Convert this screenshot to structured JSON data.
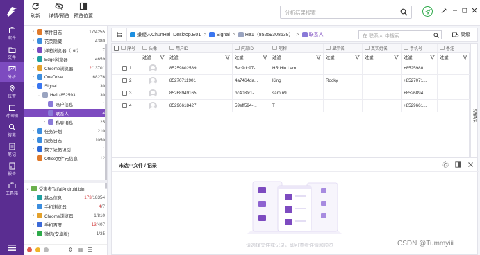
{
  "rail": {
    "items": [
      {
        "label": "案件",
        "icon": "case-icon"
      },
      {
        "label": "文件",
        "icon": "folder-icon"
      },
      {
        "label": "分析",
        "icon": "analysis-icon"
      },
      {
        "label": "位置",
        "icon": "location-icon"
      },
      {
        "label": "时间轴",
        "icon": "timeline-icon"
      },
      {
        "label": "搜索",
        "icon": "search-icon"
      },
      {
        "label": "笔记",
        "icon": "note-icon"
      },
      {
        "label": "报告",
        "icon": "report-icon"
      },
      {
        "label": "工具箱",
        "icon": "toolbox-icon"
      }
    ],
    "active_index": 2
  },
  "toolbar": {
    "refresh_label": "刷新",
    "preview_label": "详情/预览",
    "preview_pos_label": "预览位置",
    "search_placeholder": "分析结果搜索"
  },
  "tree": {
    "rows": [
      {
        "label": "事件日志",
        "count": "17/4255",
        "indent": 1,
        "arrow": ">",
        "color": "#e07a2b"
      },
      {
        "label": "花荥隐藏",
        "count": "4380",
        "indent": 1,
        "arrow": ">",
        "color": "#3c8dde"
      },
      {
        "label": "洋葱浏览器（Tor）",
        "count": "7",
        "indent": 1,
        "arrow": ">",
        "color": "#7a4bc0"
      },
      {
        "label": "Edge浏览器",
        "count": "4659",
        "indent": 1,
        "arrow": ">",
        "color": "#1ea0a0"
      },
      {
        "label": "Chrome浏览器",
        "count_red": "2",
        "count": "/13701",
        "indent": 1,
        "arrow": ">",
        "color": "#e3a12b"
      },
      {
        "label": "OneDrive",
        "count": "68276",
        "indent": 1,
        "arrow": ">",
        "color": "#3c8dde"
      },
      {
        "label": "Signal",
        "count": "30",
        "indent": 1,
        "arrow": "v",
        "color": "#3a76f0"
      },
      {
        "label": "He1 (852593...",
        "count": "30",
        "indent": 2,
        "arrow": "v",
        "color": "#9aa4c0"
      },
      {
        "label": "账户信息",
        "count": "1",
        "indent": 3,
        "arrow": "",
        "color": "#8a7ad8"
      },
      {
        "label": "联系人",
        "count": "4",
        "indent": 3,
        "arrow": "",
        "color": "#8a7ad8",
        "selected": true
      },
      {
        "label": "私聊消息",
        "count": "25",
        "indent": 3,
        "arrow": ">",
        "color": "#8a7ad8"
      },
      {
        "label": "任务计划",
        "count": "210",
        "indent": 1,
        "arrow": ">",
        "color": "#3c8dde"
      },
      {
        "label": "服务日志",
        "count": "1050",
        "indent": 1,
        "arrow": ">",
        "color": "#3c8dde"
      },
      {
        "label": "数字证据识别",
        "count": "1",
        "indent": 1,
        "arrow": ">",
        "color": "#2d6ad8"
      },
      {
        "label": "Office文件元信息",
        "count": "12",
        "indent": 1,
        "arrow": "",
        "color": "#e07a2b"
      }
    ],
    "rows2": [
      {
        "label": "受害者TaifaiAndroid.bin",
        "count": "",
        "indent": 0,
        "arrow": "v",
        "color": "#6ab04c"
      },
      {
        "label": "基本信息",
        "count_red": "173",
        "count": "/18354",
        "indent": 1,
        "arrow": ">",
        "color": "#1ea0a0"
      },
      {
        "label": "手机浏览器",
        "count_red": "4",
        "count": "/7",
        "indent": 1,
        "arrow": ">",
        "color": "#3c8dde"
      },
      {
        "label": "Chrome浏览器",
        "count": "1/810",
        "indent": 1,
        "arrow": ">",
        "color": "#e3a12b"
      },
      {
        "label": "手机百度",
        "count_red": "13",
        "count": "/407",
        "indent": 1,
        "arrow": ">",
        "color": "#3c6ad8"
      },
      {
        "label": "微信(安卓版)",
        "count": "1/35",
        "indent": 1,
        "arrow": ">",
        "color": "#2eaa4a"
      }
    ]
  },
  "breadcrumb": {
    "items": [
      {
        "label": "嫌疑人ChunHei_Desktop.E01",
        "color": "#1d8fe0"
      },
      {
        "label": "Signal",
        "color": "#3a76f0"
      },
      {
        "label": "He1（85259308538）",
        "color": "#9aa4c0"
      },
      {
        "label": "联系人",
        "color": "#8a7ad8"
      }
    ],
    "search_placeholder": "在 联系人 中搜索",
    "advanced_label": "高级"
  },
  "grid": {
    "columns": [
      "序号",
      "头像",
      "用户ID",
      "内部ID",
      "昵称",
      "显示名",
      "真实姓名",
      "手机号",
      "备注"
    ],
    "filter_label": "过滤",
    "rows": [
      {
        "index": "1",
        "user_id": "85259802589",
        "inner_id": "5ec9dc97-...",
        "nickname": "HR Hiu Lam",
        "display": "",
        "real": "",
        "phone": "+8525980...",
        "note": ""
      },
      {
        "index": "2",
        "user_id": "85270711901",
        "inner_id": "4a7464da...",
        "nickname": "King",
        "display": "Rocky",
        "real": "",
        "phone": "+8527071...",
        "note": ""
      },
      {
        "index": "3",
        "user_id": "85268949165",
        "inner_id": "bc403fc1-...",
        "nickname": "sam n9",
        "display": "",
        "real": "",
        "phone": "+8526894...",
        "note": ""
      },
      {
        "index": "4",
        "user_id": "85296618427",
        "inner_id": "59eff594-...",
        "nickname": "T",
        "display": "",
        "real": "",
        "phone": "+8529661...",
        "note": ""
      }
    ],
    "settings_col_label": "设置列"
  },
  "detail": {
    "title": "未选中文件 / 记录",
    "empty_hint": "请选择文件或记录，即可查看详情和预览"
  },
  "watermark": "CSDN @Tummyiii",
  "colors": {
    "accent": "#7d4bc0",
    "rail": "#5a2d91",
    "green": "#2eaa4a"
  }
}
